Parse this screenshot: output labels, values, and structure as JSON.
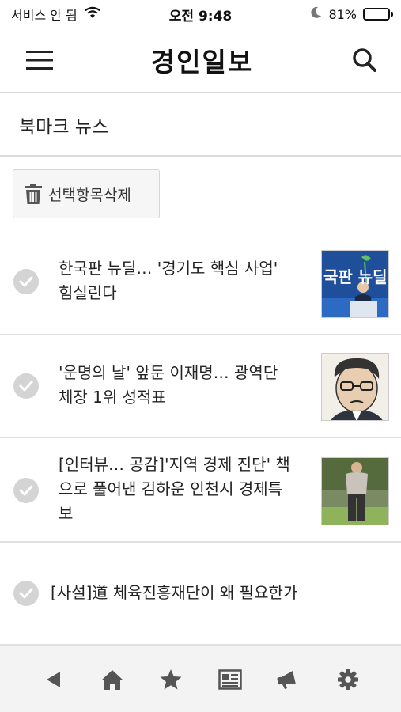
{
  "status_bar": {
    "carrier": "서비스 안 됨",
    "time": "오전 9:48",
    "battery_percent_label": "81%",
    "battery_level": 0.81
  },
  "header": {
    "masthead": "경인일보"
  },
  "page": {
    "section_title": "북마크 뉴스",
    "delete_label": "선택항목삭제"
  },
  "news": [
    {
      "title_line1": "한국판 뉴딜… '경기도 핵심 사업'",
      "title_line2": "힘실린다",
      "title_line3": "",
      "has_thumb": true,
      "thumb_caption": "국판 뉴딜"
    },
    {
      "title_line1": "'운명의 날' 앞둔 이재명… 광역단",
      "title_line2": "체장 1위 성적표",
      "title_line3": "",
      "has_thumb": true
    },
    {
      "title_line1": "[인터뷰… 공감]'지역 경제 진단' 책",
      "title_line2": "으로 풀어낸 김하운 인천시 경제특",
      "title_line3": "보",
      "has_thumb": true
    },
    {
      "title_line1": "[사설]道 체육진흥재단이 왜 필요한가",
      "title_line2": "",
      "title_line3": "",
      "has_thumb": false
    }
  ],
  "bottom_nav": {
    "items": [
      "back-icon",
      "home-icon",
      "star-icon",
      "newspaper-icon",
      "megaphone-icon",
      "gear-icon"
    ]
  },
  "colors": {
    "divider": "#dcdcdc",
    "check_gray": "#d4d4d4",
    "nav_icon": "#555555",
    "nav_bg": "#f3f3f3"
  }
}
